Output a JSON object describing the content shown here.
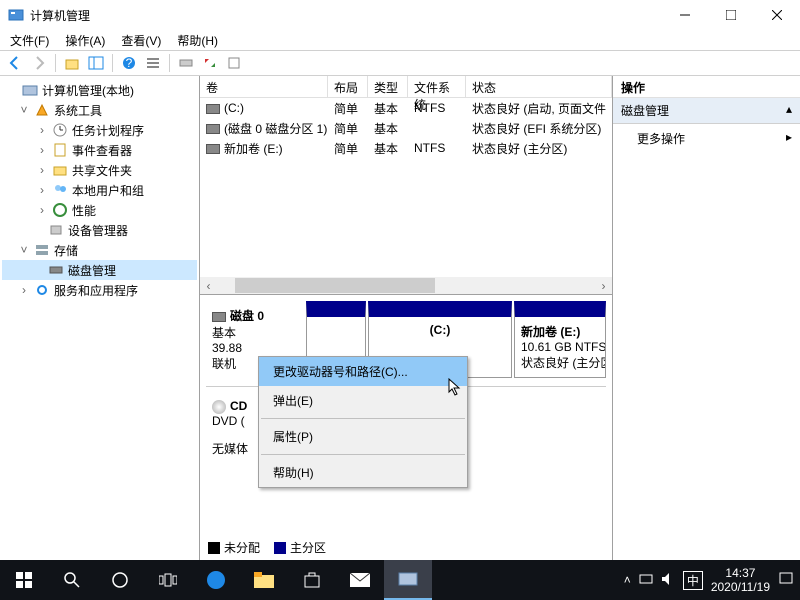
{
  "titlebar": {
    "title": "计算机管理"
  },
  "menubar": {
    "file": "文件(F)",
    "action": "操作(A)",
    "view": "查看(V)",
    "help": "帮助(H)"
  },
  "tree": {
    "root": "计算机管理(本地)",
    "systools": "系统工具",
    "scheduler": "任务计划程序",
    "eventviewer": "事件查看器",
    "shared": "共享文件夹",
    "users": "本地用户和组",
    "perf": "性能",
    "devmgr": "设备管理器",
    "storage": "存储",
    "diskmgmt": "磁盘管理",
    "services": "服务和应用程序"
  },
  "list": {
    "headers": {
      "vol": "卷",
      "layout": "布局",
      "type": "类型",
      "fs": "文件系统",
      "status": "状态"
    },
    "rows": [
      {
        "vol": "(C:)",
        "layout": "简单",
        "type": "基本",
        "fs": "NTFS",
        "status": "状态良好 (启动, 页面文件"
      },
      {
        "vol": "(磁盘 0 磁盘分区 1)",
        "layout": "简单",
        "type": "基本",
        "fs": "",
        "status": "状态良好 (EFI 系统分区)"
      },
      {
        "vol": "新加卷 (E:)",
        "layout": "简单",
        "type": "基本",
        "fs": "NTFS",
        "status": "状态良好 (主分区)"
      }
    ]
  },
  "disk0": {
    "name": "磁盘 0",
    "type": "基本",
    "size": "39.88",
    "status": "联机",
    "partC": {
      "label": "(C:)"
    },
    "partE": {
      "label": "新加卷  (E:)",
      "size": "10.61 GB NTFS",
      "status": "状态良好 (主分区"
    }
  },
  "cdrom": {
    "name": "CD",
    "type": "DVD (",
    "media": "无媒体"
  },
  "legend": {
    "unalloc": "未分配",
    "primary": "主分区"
  },
  "actions": {
    "header": "操作",
    "section": "磁盘管理",
    "more": "更多操作"
  },
  "ctx": {
    "change": "更改驱动器号和路径(C)...",
    "eject": "弹出(E)",
    "props": "属性(P)",
    "help": "帮助(H)"
  },
  "tray": {
    "ime": "中",
    "time": "14:37",
    "date": "2020/11/19"
  }
}
